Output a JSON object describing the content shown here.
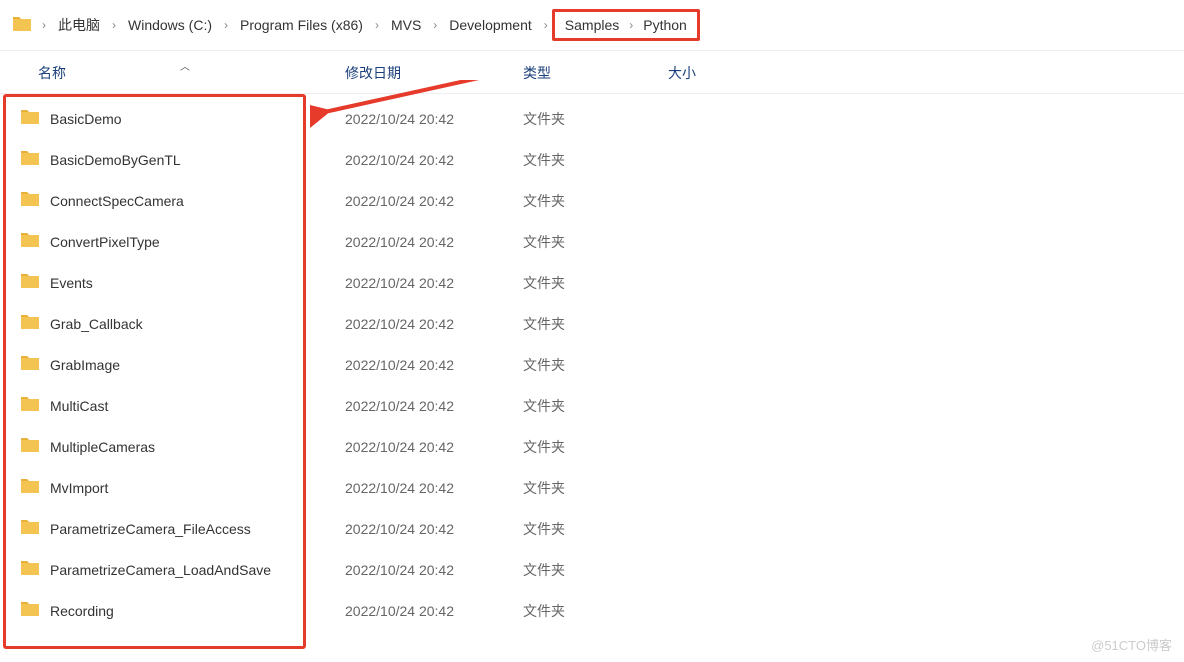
{
  "breadcrumb": {
    "items": [
      {
        "label": "此电脑"
      },
      {
        "label": "Windows (C:)"
      },
      {
        "label": "Program Files (x86)"
      },
      {
        "label": "MVS"
      },
      {
        "label": "Development"
      },
      {
        "label": "Samples"
      },
      {
        "label": "Python"
      }
    ]
  },
  "columns": {
    "name": "名称",
    "date": "修改日期",
    "type": "类型",
    "size": "大小"
  },
  "rows": [
    {
      "name": "BasicDemo",
      "date": "2022/10/24 20:42",
      "type": "文件夹",
      "size": ""
    },
    {
      "name": "BasicDemoByGenTL",
      "date": "2022/10/24 20:42",
      "type": "文件夹",
      "size": ""
    },
    {
      "name": "ConnectSpecCamera",
      "date": "2022/10/24 20:42",
      "type": "文件夹",
      "size": ""
    },
    {
      "name": "ConvertPixelType",
      "date": "2022/10/24 20:42",
      "type": "文件夹",
      "size": ""
    },
    {
      "name": "Events",
      "date": "2022/10/24 20:42",
      "type": "文件夹",
      "size": ""
    },
    {
      "name": "Grab_Callback",
      "date": "2022/10/24 20:42",
      "type": "文件夹",
      "size": ""
    },
    {
      "name": "GrabImage",
      "date": "2022/10/24 20:42",
      "type": "文件夹",
      "size": ""
    },
    {
      "name": "MultiCast",
      "date": "2022/10/24 20:42",
      "type": "文件夹",
      "size": ""
    },
    {
      "name": "MultipleCameras",
      "date": "2022/10/24 20:42",
      "type": "文件夹",
      "size": ""
    },
    {
      "name": "MvImport",
      "date": "2022/10/24 20:42",
      "type": "文件夹",
      "size": ""
    },
    {
      "name": "ParametrizeCamera_FileAccess",
      "date": "2022/10/24 20:42",
      "type": "文件夹",
      "size": ""
    },
    {
      "name": "ParametrizeCamera_LoadAndSave",
      "date": "2022/10/24 20:42",
      "type": "文件夹",
      "size": ""
    },
    {
      "name": "Recording",
      "date": "2022/10/24 20:42",
      "type": "文件夹",
      "size": ""
    }
  ],
  "watermark": "@51CTO博客",
  "colors": {
    "annotation": "#e63a2b",
    "folder_fill": "#f4c452",
    "folder_tab": "#e8b23a",
    "header_text": "#1a3f7a"
  }
}
